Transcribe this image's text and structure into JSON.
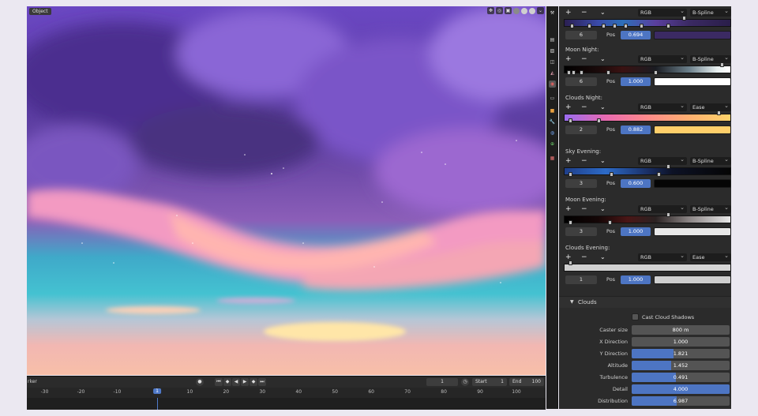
{
  "viewport": {
    "mode_label": "Object",
    "header_icons": [
      "gizmo-icon",
      "overlay-icon",
      "xray-icon",
      "solid-shading-icon",
      "material-shading-icon",
      "rendered-shading-icon"
    ]
  },
  "timeline": {
    "marker_label": "rker",
    "current_frame": "1",
    "start_label": "Start",
    "start_value": "1",
    "end_label": "End",
    "end_value": "100",
    "ruler_ticks": [
      "-30",
      "-20",
      "-10",
      "1",
      "10",
      "20",
      "30",
      "40",
      "50",
      "60",
      "70",
      "80",
      "90",
      "100"
    ]
  },
  "ramps": [
    {
      "title": "",
      "color_mode": "RGB",
      "interpolation": "B-Spline",
      "index": "6",
      "pos_label": "Pos",
      "pos": "0.694",
      "swatch_color": "#3b2a63",
      "gradient": "linear-gradient(90deg,#2b1f52 0%,#3a4aa8 20%,#2e6fb8 35%,#5a3f9e 55%,#3b2a63 75%,#2a1e4a 100%)"
    },
    {
      "title": "Moon Night:",
      "color_mode": "RGB",
      "interpolation": "B-Spline",
      "index": "6",
      "pos_label": "Pos",
      "pos": "1.000",
      "swatch_color": "#ffffff",
      "gradient": "linear-gradient(90deg,#000 0%,#1a0a0a 20%,#3a1212 35%,#1a1c22 55%,#6b7f8a 75%,#e8f0f0 92%,#ffffff 100%)"
    },
    {
      "title": "Clouds Night:",
      "color_mode": "RGB",
      "interpolation": "Ease",
      "index": "2",
      "pos_label": "Pos",
      "pos": "0.882",
      "swatch_color": "#ffcf6a",
      "gradient": "linear-gradient(90deg,#9a6cf0 0%,#e86ab0 25%,#ff8a8a 50%,#ffb070 75%,#ffd36a 100%)"
    },
    {
      "title": "Sky Evening:",
      "color_mode": "RGB",
      "interpolation": "B-Spline",
      "index": "3",
      "pos_label": "Pos",
      "pos": "0.600",
      "swatch_color": "#050505",
      "gradient": "linear-gradient(90deg,#1f3f8a 0%,#2d6bc8 25%,#1a2f66 50%,#0d1226 65%,#050505 100%)"
    },
    {
      "title": "Moon Evening:",
      "color_mode": "RGB",
      "interpolation": "B-Spline",
      "index": "3",
      "pos_label": "Pos",
      "pos": "1.000",
      "swatch_color": "#e8e8e8",
      "gradient": "linear-gradient(90deg,#000 0%,#140606 20%,#4a1616 38%,#2a2222 55%,#8a8484 75%,#e8e8e8 100%)"
    },
    {
      "title": "Clouds Evening:",
      "color_mode": "RGB",
      "interpolation": "Ease",
      "index": "1",
      "pos_label": "Pos",
      "pos": "1.000",
      "swatch_color": "#cfcfcf",
      "gradient": "linear-gradient(90deg,#cfcfcf 0%,#d6d6d6 100%)"
    }
  ],
  "clouds_panel": {
    "title": "Clouds",
    "cast_shadows_label": "Cast Cloud Shadows",
    "properties": [
      {
        "label": "Caster size",
        "value": "800 m",
        "fill": 0
      },
      {
        "label": "X Direction",
        "value": "1.000",
        "fill": 0
      },
      {
        "label": "Y Direction",
        "value": "1.821",
        "fill": 0.43
      },
      {
        "label": "Altitude",
        "value": "1.452",
        "fill": 0.4
      },
      {
        "label": "Turbulence",
        "value": "0.491",
        "fill": 0.45
      },
      {
        "label": "Detail",
        "value": "4.000",
        "fill": 1.0
      },
      {
        "label": "Distribution",
        "value": "6.987",
        "fill": 0.46
      }
    ]
  },
  "colors": {
    "accent_blue": "#4d75c3",
    "panel_bg": "#2b2b2b",
    "field_bg": "#545454"
  }
}
